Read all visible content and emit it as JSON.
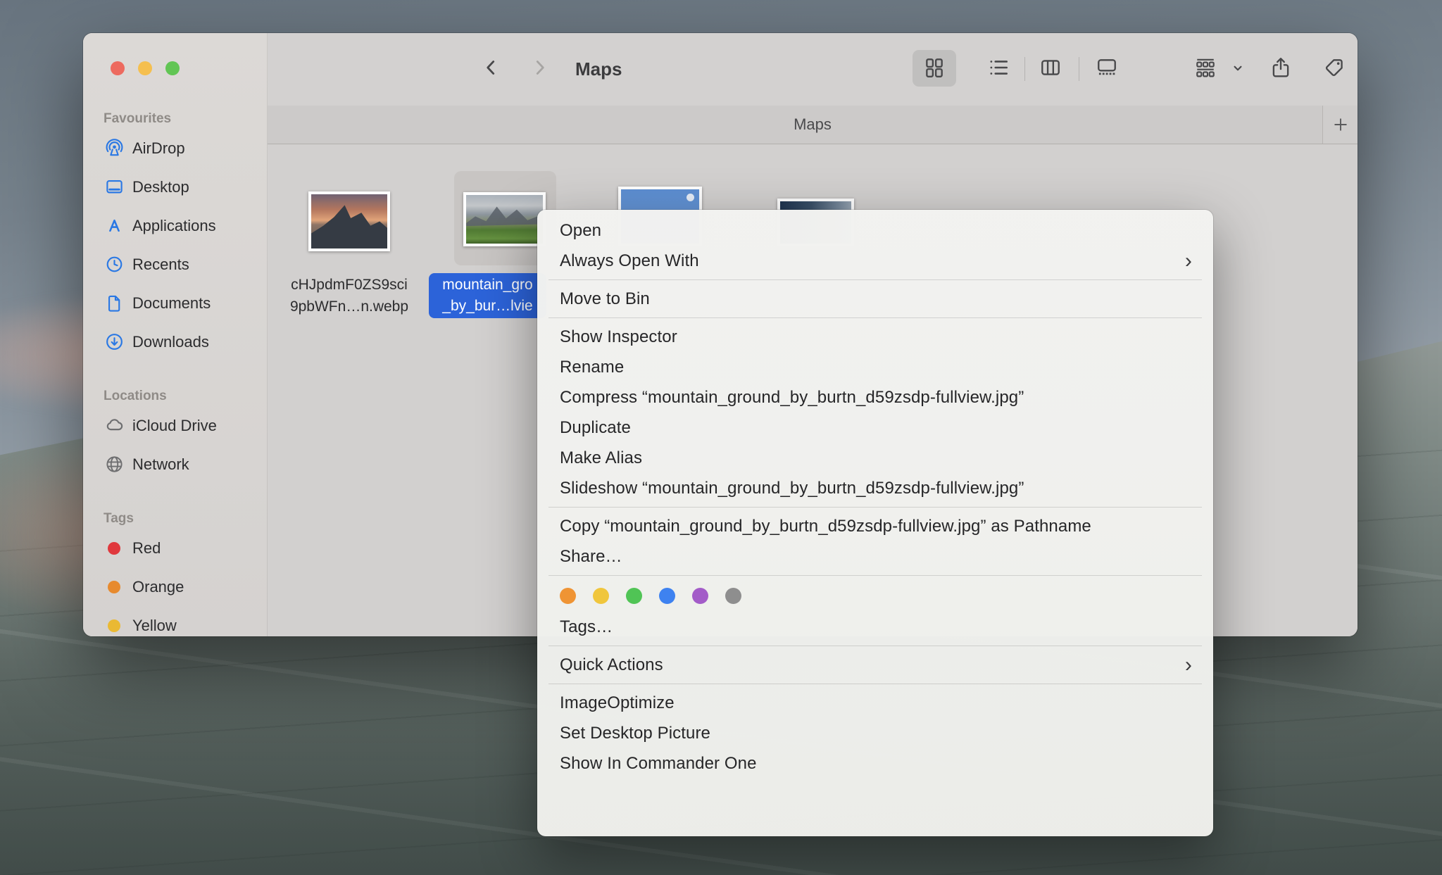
{
  "window": {
    "toolbar": {
      "title": "Maps",
      "buttons": [
        "back",
        "forward",
        "grid-view",
        "list-view",
        "columns-view",
        "gallery-view",
        "group-by",
        "share",
        "tags",
        "more-actions",
        "search"
      ]
    },
    "tab_bar": {
      "active_tab": "Maps",
      "new_tab_label": "+"
    },
    "sidebar": {
      "sections": [
        {
          "heading": "Favourites",
          "items": [
            {
              "label": "AirDrop",
              "icon": "airdrop-icon"
            },
            {
              "label": "Desktop",
              "icon": "desktop-icon"
            },
            {
              "label": "Applications",
              "icon": "applications-icon"
            },
            {
              "label": "Recents",
              "icon": "recents-icon"
            },
            {
              "label": "Documents",
              "icon": "documents-icon"
            },
            {
              "label": "Downloads",
              "icon": "downloads-icon"
            }
          ]
        },
        {
          "heading": "Locations",
          "items": [
            {
              "label": "iCloud Drive",
              "icon": "icloud-icon"
            },
            {
              "label": "Network",
              "icon": "network-icon"
            }
          ]
        },
        {
          "heading": "Tags",
          "items": [
            {
              "label": "Red",
              "icon": "tag-dot-icon",
              "dot": "#e0383d"
            },
            {
              "label": "Orange",
              "icon": "tag-dot-icon",
              "dot": "#e78a2e"
            },
            {
              "label": "Yellow",
              "icon": "tag-dot-icon",
              "dot": "#eab933"
            }
          ]
        }
      ]
    },
    "files": [
      {
        "name_lines": [
          "cHJpdmF0ZS9sci",
          "9pbWFn…n.webp"
        ],
        "selected": false,
        "thumb": "matterhorn-sunset-photo"
      },
      {
        "name_lines": [
          "mountain_gro",
          "_by_bur…lvie"
        ],
        "selected": true,
        "thumb": "green-alps-photo"
      },
      {
        "name_lines": [],
        "selected": false,
        "thumb": "blue-sky-moon-photo"
      },
      {
        "name_lines": [],
        "selected": false,
        "thumb": "dark-ocean-photo"
      }
    ]
  },
  "context_menu": {
    "sections": [
      {
        "items": [
          {
            "label": "Open"
          },
          {
            "label": "Always Open With",
            "submenu": true
          }
        ]
      },
      {
        "items": [
          {
            "label": "Move to Bin"
          }
        ]
      },
      {
        "items": [
          {
            "label": "Show Inspector"
          },
          {
            "label": "Rename"
          },
          {
            "label": "Compress “mountain_ground_by_burtn_d59zsdp-fullview.jpg”"
          },
          {
            "label": "Duplicate"
          },
          {
            "label": "Make Alias"
          },
          {
            "label": "Slideshow “mountain_ground_by_burtn_d59zsdp-fullview.jpg”"
          }
        ]
      },
      {
        "items": [
          {
            "label": "Copy “mountain_ground_by_burtn_d59zsdp-fullview.jpg” as Pathname"
          },
          {
            "label": "Share…"
          }
        ]
      },
      {
        "tag_dots": [
          "#ef9434",
          "#f0c63c",
          "#50c455",
          "#3e82f0",
          "#a35cc8",
          "#8e8e8e"
        ],
        "items": [
          {
            "label": "Tags…"
          }
        ]
      },
      {
        "items": [
          {
            "label": "Quick Actions",
            "submenu": true
          }
        ]
      },
      {
        "items": [
          {
            "label": "ImageOptimize"
          },
          {
            "label": "Set Desktop Picture"
          },
          {
            "label": "Show In Commander One"
          }
        ]
      }
    ]
  },
  "colors": {
    "selection_blue": "#2c63d9",
    "traffic_lights": [
      "#ed6a5f",
      "#f5bf4f",
      "#62c554"
    ],
    "sidebar_icon_blue": "#2a78e4",
    "sidebar_icon_gray": "#6e6e70"
  }
}
